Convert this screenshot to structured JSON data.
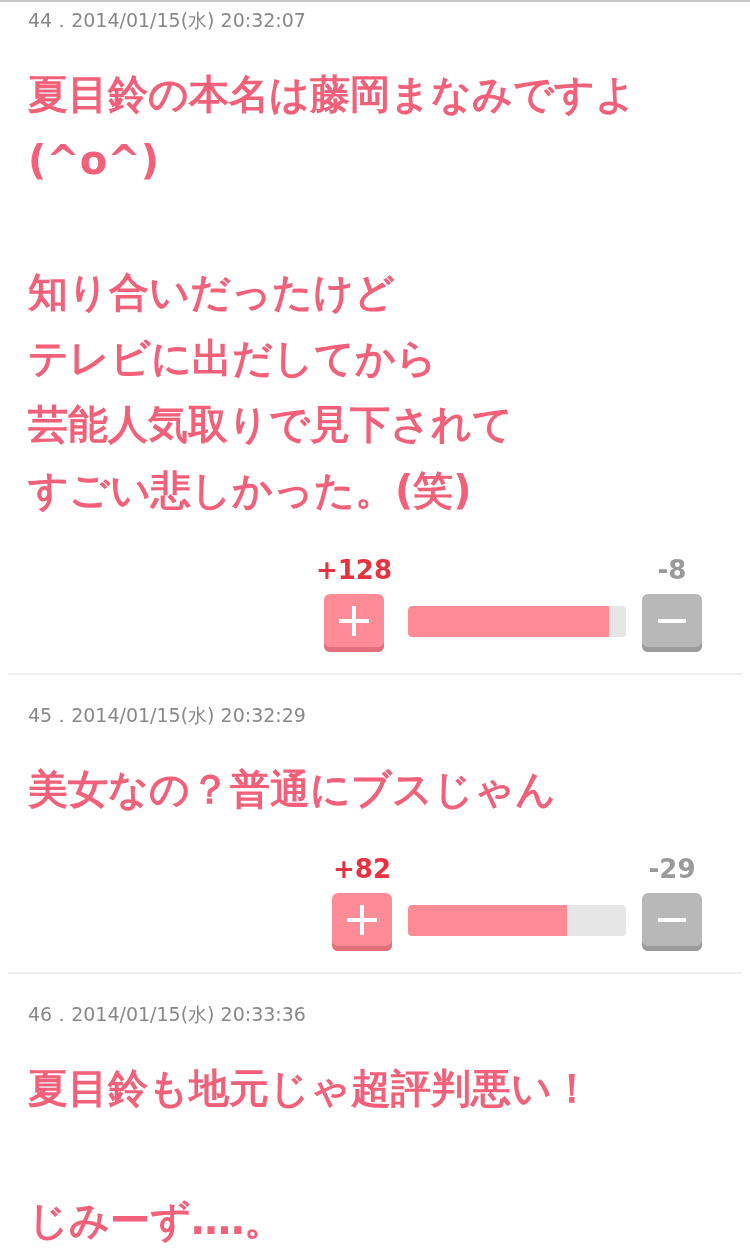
{
  "comments": [
    {
      "number": "44．",
      "posted_at": "2014/01/15(水) 20:32:07",
      "paragraphs": [
        [
          "夏目鈴の本名は藤岡まなみですよ(^o^)"
        ],
        [
          "知り合いだったけど",
          "テレビに出だしてから",
          "芸能人気取りで見下されて",
          "すごい悲しかった。(笑)"
        ]
      ],
      "votes": {
        "plus": "+128",
        "minus": "-8",
        "level": 0.92
      }
    },
    {
      "number": "45．",
      "posted_at": "2014/01/15(水) 20:32:29",
      "paragraphs": [
        [
          "美女なの？普通にブスじゃん"
        ]
      ],
      "votes": {
        "plus": "+82",
        "minus": "-29",
        "level": 0.73
      }
    },
    {
      "number": "46．",
      "posted_at": "2014/01/15(水) 20:33:36",
      "paragraphs": [
        [
          "夏目鈴も地元じゃ超評判悪い！"
        ],
        [
          "じみーず‥‥。"
        ]
      ]
    }
  ]
}
